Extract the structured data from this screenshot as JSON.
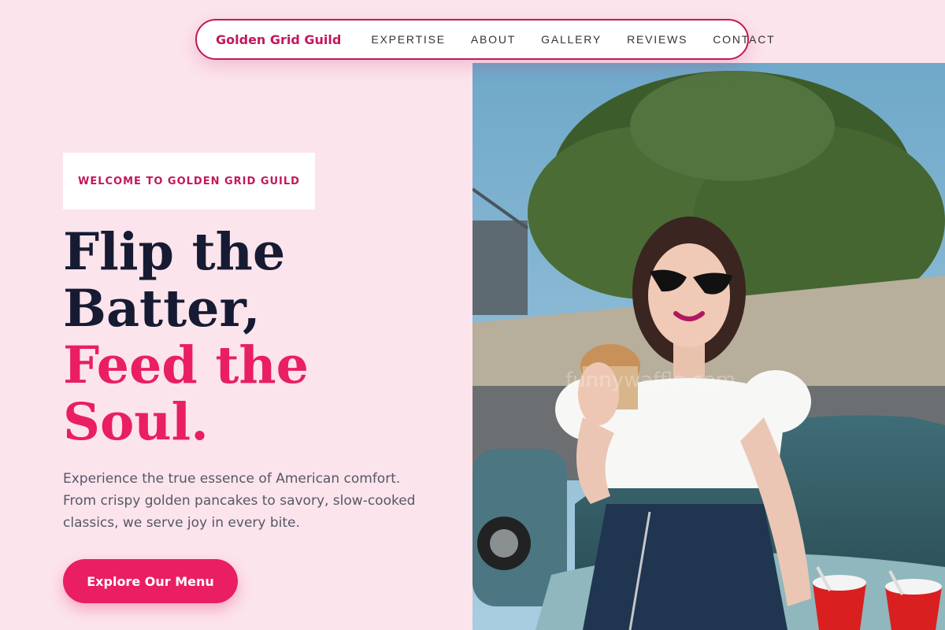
{
  "nav": {
    "brand": "Golden Grid Guild",
    "links": [
      "EXPERTISE",
      "ABOUT",
      "GALLERY",
      "REVIEWS",
      "CONTACT"
    ]
  },
  "hero": {
    "badge": "WELCOME TO GOLDEN GRID GUILD",
    "headline_line1": "Flip the",
    "headline_line2": "Batter,",
    "headline_line3": "Feed the",
    "headline_line4": "Soul.",
    "description": "Experience the true essence of American comfort. From crispy golden pancakes to savory, slow-cooked classics, we serve joy in every bite.",
    "cta_label": "Explore Our Menu"
  },
  "photo": {
    "watermark": "funnywaffle.com"
  },
  "colors": {
    "page_bg": "#fce4ec",
    "brand": "#c2185b",
    "accent": "#e91e63",
    "heading_dark": "#161b33"
  }
}
